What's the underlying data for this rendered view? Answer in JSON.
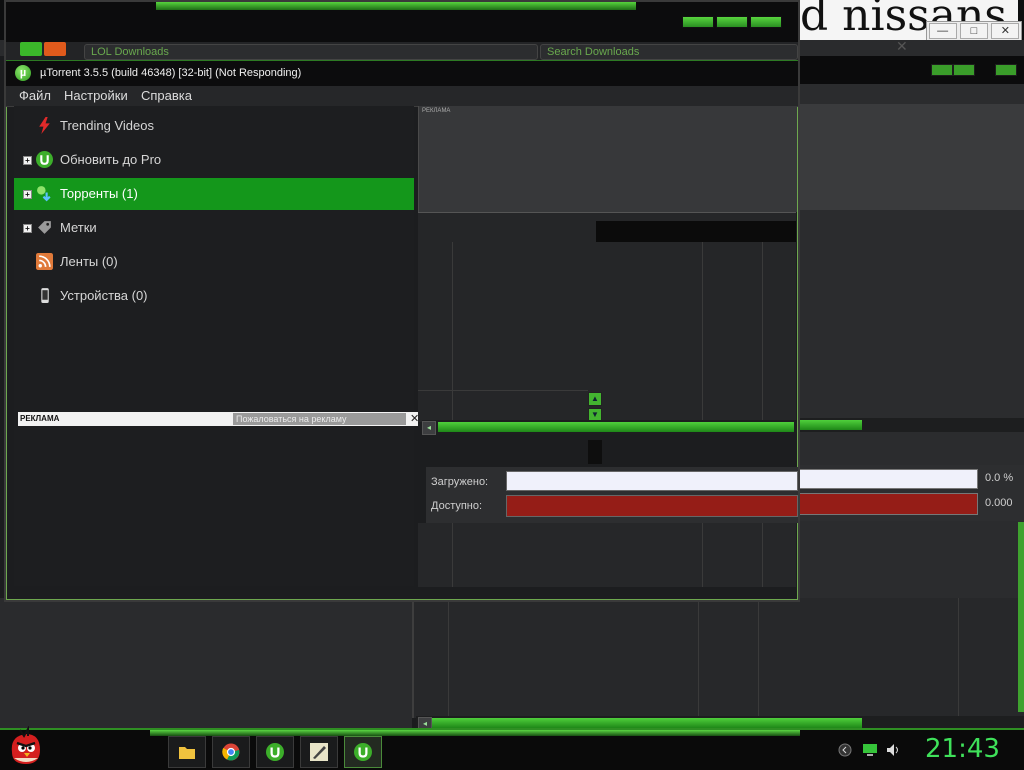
{
  "background": {
    "handwriting_text": "d nissans",
    "window_controls": [
      "—",
      "□",
      "✕"
    ],
    "close_glyph": "✕"
  },
  "window": {
    "title": "µTorrent 3.5.5  (build 46348) [32-bit] (Not Responding)",
    "logo_glyph": "µ",
    "tabs": [
      {
        "label": "LOL      Downloads"
      },
      {
        "label": "Search Downloads"
      }
    ]
  },
  "menu": {
    "items": [
      "Файл",
      "Настройки",
      "Справка"
    ]
  },
  "sidebar": {
    "items": [
      {
        "label": "Trending Videos",
        "icon": "lightning-icon",
        "expander": false,
        "active": false
      },
      {
        "label": "Обновить до Pro",
        "icon": "utorrent-icon",
        "expander": true,
        "active": false
      },
      {
        "label": "Торренты (1)",
        "icon": "torrents-icon",
        "expander": true,
        "active": true
      },
      {
        "label": "Метки",
        "icon": "tag-icon",
        "expander": true,
        "active": false
      },
      {
        "label": "Ленты (0)",
        "icon": "rss-icon",
        "expander": false,
        "active": false
      },
      {
        "label": "Устройства (0)",
        "icon": "device-icon",
        "expander": false,
        "active": false
      }
    ],
    "expander_glyph": "+"
  },
  "ad": {
    "label": "РЕКЛАМА",
    "complain": "Пожаловаться на рекламу",
    "close": "✕",
    "area_label": "РЕКЛАМА"
  },
  "info": {
    "downloaded_label": "Загружено:",
    "downloaded_value": "0.0 %",
    "available_label": "Доступно:",
    "available_value": "0.000"
  },
  "taskbar": {
    "clock": "21:43",
    "apps": [
      "folder-icon",
      "chrome-icon",
      "utorrent-icon",
      "pen-tool-icon",
      "utorrent-icon"
    ]
  },
  "colors": {
    "accent_green": "#14971b",
    "available_bar": "#951d17",
    "clock": "#3fe15a"
  }
}
